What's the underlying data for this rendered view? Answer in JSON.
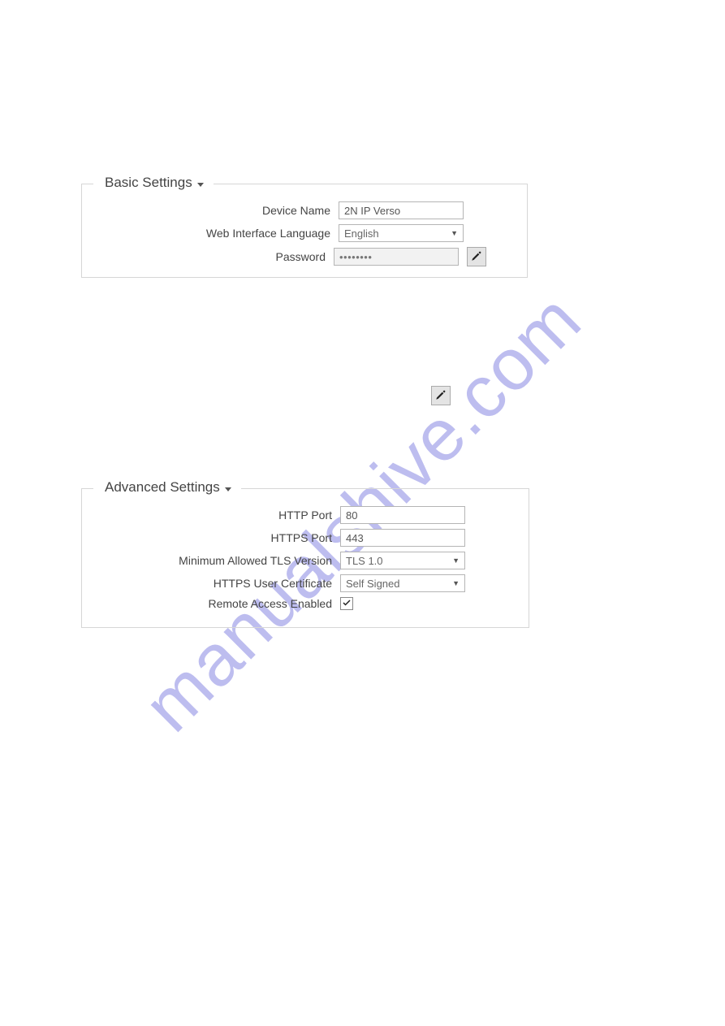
{
  "watermark": "manualshive.com",
  "basic": {
    "title": "Basic Settings",
    "fields": {
      "device_name_label": "Device Name",
      "device_name_value": "2N IP Verso",
      "web_lang_label": "Web Interface Language",
      "web_lang_value": "English",
      "password_label": "Password",
      "password_value": "••••••••"
    }
  },
  "advanced": {
    "title": "Advanced Settings",
    "fields": {
      "http_port_label": "HTTP Port",
      "http_port_value": "80",
      "https_port_label": "HTTPS Port",
      "https_port_value": "443",
      "tls_label": "Minimum Allowed TLS Version",
      "tls_value": "TLS 1.0",
      "cert_label": "HTTPS User Certificate",
      "cert_value": "Self Signed",
      "remote_label": "Remote Access Enabled"
    }
  }
}
